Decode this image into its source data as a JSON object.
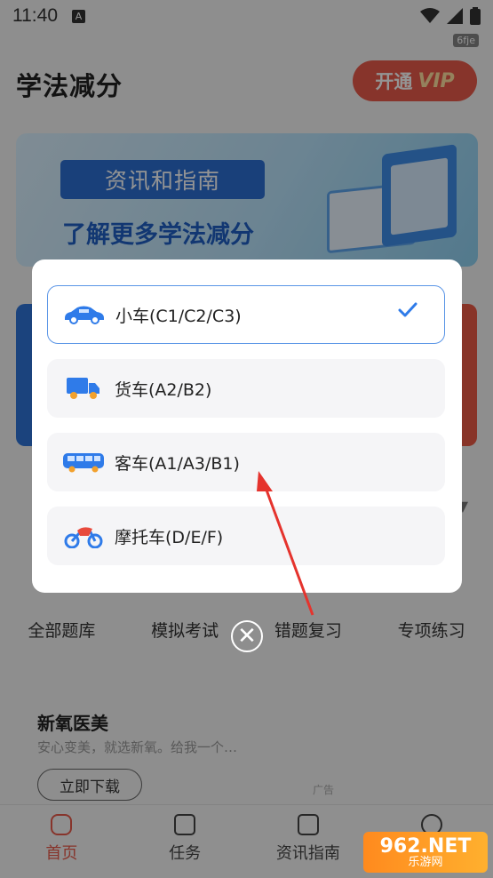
{
  "status": {
    "time": "11:40",
    "a_badge": "A",
    "tag": "6fje"
  },
  "header": {
    "title": "学法减分",
    "vip_button": "开通",
    "vip_suffix": "VIP"
  },
  "banner": {
    "tag": "资讯和指南",
    "subtitle": "了解更多学法减分"
  },
  "grid": [
    "全部题库",
    "模拟考试",
    "错题复习",
    "专项练习"
  ],
  "ad": {
    "title": "新氧医美",
    "desc": "安心变美，就选新氧。给我一个…",
    "button": "立即下载",
    "mark": "广告"
  },
  "tabs": [
    "首页",
    "任务",
    "资讯指南",
    ""
  ],
  "watermark": {
    "main": "962.NET",
    "sub": "乐游网"
  },
  "dialog": {
    "options": [
      {
        "label": "小车(C1/C2/C3)",
        "icon": "car-icon",
        "selected": true
      },
      {
        "label": "货车(A2/B2)",
        "icon": "truck-icon",
        "selected": false
      },
      {
        "label": "客车(A1/A3/B1)",
        "icon": "bus-icon",
        "selected": false
      },
      {
        "label": "摩托车(D/E/F)",
        "icon": "motorcycle-icon",
        "selected": false
      }
    ],
    "close": "✕"
  },
  "colors": {
    "accent": "#e85b4a",
    "selected_border": "#5a95e6",
    "icon_blue": "#2f7be9",
    "annotation_arrow": "#e5332d"
  }
}
